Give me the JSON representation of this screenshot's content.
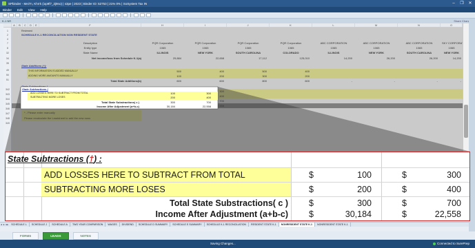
{
  "window": {
    "title": "SPbinder - Mei7n, Khrrk (iop9f7_2j9no) | s3pe | 2023 | Binder ID: 52753 | 21% 0% | SoSystem Tax IN",
    "controls": [
      "–",
      "❐",
      "✕"
    ]
  },
  "menu": [
    "Binder",
    "Edit",
    "View",
    "Help"
  ],
  "doc_tab": {
    "label": "K-1 NR",
    "right_label": "Share Changes"
  },
  "sheet": {
    "columns": [
      "A",
      "B",
      "C",
      "D",
      "E",
      "F",
      "H",
      "I",
      "J",
      "K",
      "L",
      "M",
      "N",
      "O"
    ],
    "reviewed_label": "Reviewed",
    "title": "SCHEDULE K-1 RECONCILIATION NON RESIDENT STATE",
    "row_labels": {
      "description": "Description",
      "entity_type": "Entity type",
      "state_name": "State Name",
      "net_income": "Net income/loss from Schedule K-1(a)",
      "state_additions": "State Additions (†):",
      "added_manually": "THIS INFORMATION IS ADDED MANUALLY",
      "adding_more": "ADDING MORE AMOUNTS MANUALLY",
      "total_additions": "Total State Additions(b)",
      "note1": "* - Please enter manually",
      "note2": "Please recalculate the Leadsheet to add the new rows"
    },
    "companies": [
      "PQR Corporation",
      "PQR Corporation",
      "PQR Corporation",
      "PQR Corporation",
      "ABC CORPORATION",
      "ABC CORPORATION",
      "ABC CORPORATION",
      "SKY CORPORATI"
    ],
    "entity_types": [
      "1065",
      "1065",
      "1065",
      "1065",
      "1065",
      "1065",
      "1065",
      "1065"
    ],
    "states": [
      "ILLINOIS",
      "NEW YORK",
      "SOUTH CAROLINA",
      "COLORADO",
      "ILLINOIS",
      "NEW YORK",
      "SOUTH CAROLINA",
      "NEW YORK"
    ],
    "net_income": [
      "29,884",
      "22,658",
      "17,112",
      "125,010",
      "14,200",
      "26,200",
      "26,200",
      "14,200"
    ],
    "add_row1": [
      "500",
      "400",
      "500",
      "400"
    ],
    "add_row2": [
      "100",
      "200",
      "300",
      "200"
    ],
    "total_add": [
      "600",
      "600",
      "800",
      "600",
      "-",
      "-",
      "-",
      "-"
    ],
    "row_numbers": [
      "1",
      "2",
      "4",
      "7",
      "8",
      "32",
      "34",
      "35",
      "49",
      "50",
      "51",
      "342",
      "343",
      "344",
      "345",
      "346",
      "347",
      "348",
      "349"
    ]
  },
  "zoom": {
    "heading": "State Subtractions (",
    "dagger": "†",
    "heading_end": ") :",
    "rows": [
      {
        "label": "ADD LOSSES HERE TO SUBTRACT FROM TOTAL",
        "cur1": "$",
        "v1": "100",
        "cur2": "$",
        "v2": "300"
      },
      {
        "label": "SUBTRACTING MORE LOSES",
        "cur1": "$",
        "v1": "200",
        "cur2": "$",
        "v2": "400"
      },
      {
        "label": "Total State Substractions( c )",
        "cur1": "$",
        "v1": "300",
        "cur2": "$",
        "v2": "700"
      },
      {
        "label": "Income After Adjustment (a+b-c)",
        "cur1": "$",
        "v1": "30,184",
        "cur2": "$",
        "v2": "22,558"
      }
    ]
  },
  "sheet_tabs": [
    "SCHEDULE L",
    "SCHEDULE J",
    "SCHEDULE A",
    "TWO YEAR COMPARISON",
    "WAGES",
    "DIVIDEND",
    "SCHEDULE D SUMMARY",
    "SCHEDULE E SUMMARY",
    "SCHEDULE K-1 RECONCILIATION",
    "RESIDENT STATE K-1",
    "NONRESIDENT STATE K-1",
    "NONRESIDENT STATE K-1"
  ],
  "sheet_tab_nav": [
    "◂",
    "▸",
    "▸▸"
  ],
  "bottom_tabs": [
    "FORMS",
    "LEADS",
    "NOTES"
  ],
  "status": {
    "saving": "Saving Changes...",
    "connection": "Connected to SurePrep"
  },
  "colors": {
    "highlight": "#ffff99",
    "callout_border": "#d32222",
    "accent_blue": "#1f4a78"
  }
}
